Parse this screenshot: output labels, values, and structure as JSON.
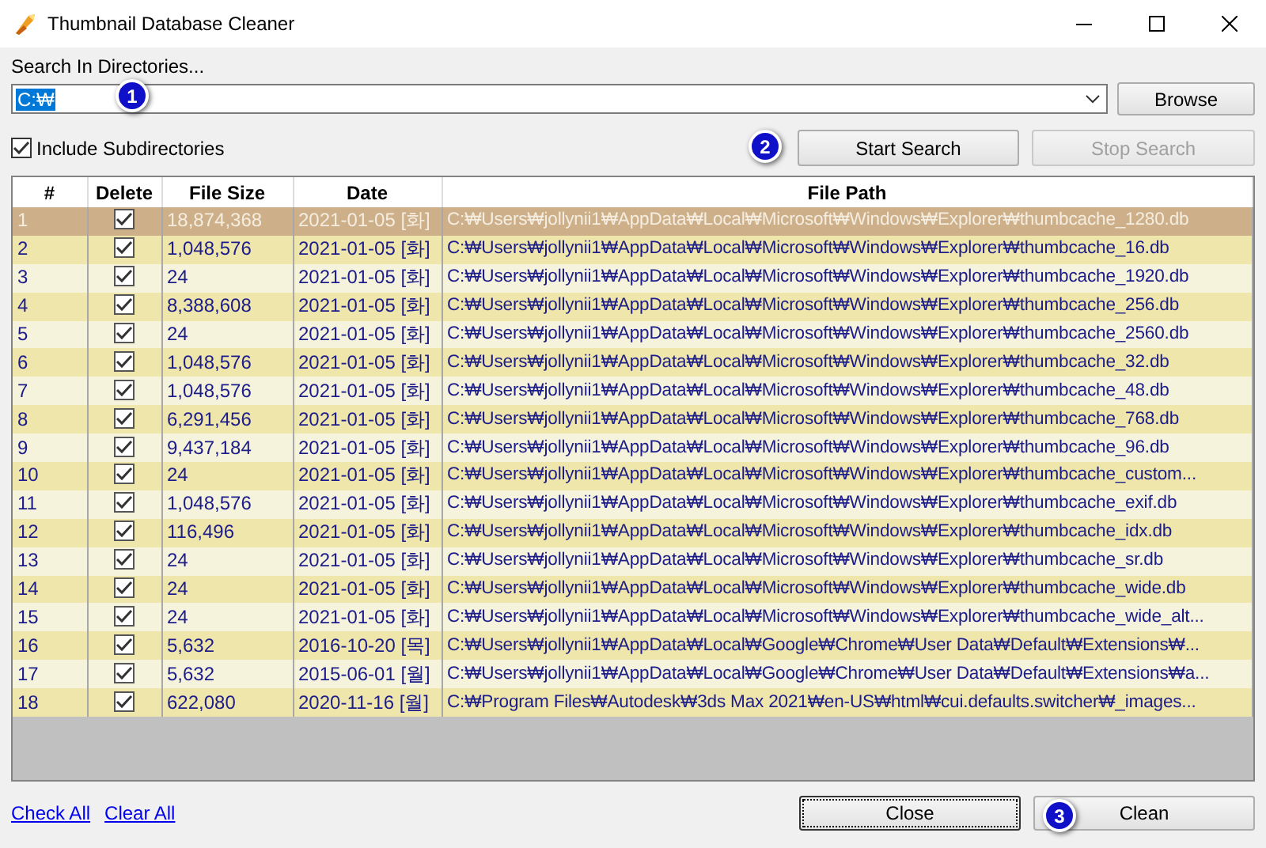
{
  "window": {
    "title": "Thumbnail Database Cleaner"
  },
  "search": {
    "label": "Search In Directories...",
    "value": "C:₩",
    "value_highlighted": true,
    "marker": "1",
    "browse": "Browse"
  },
  "options": {
    "include_subdirectories": {
      "label": "Include Subdirectories",
      "checked": true
    },
    "marker": "2",
    "start_search": {
      "label": "Start Search",
      "disabled": false
    },
    "stop_search": {
      "label": "Stop Search",
      "disabled": true
    }
  },
  "table": {
    "columns": [
      "#",
      "Delete",
      "File Size",
      "Date",
      "File Path"
    ],
    "rows": [
      {
        "number": "1",
        "delete": true,
        "file_size": "18,874,368",
        "date": "2021-01-05 [화]",
        "file_path": "C:₩Users₩jollynii1₩AppData₩Local₩Microsoft₩Windows₩Explorer₩thumbcache_1280.db",
        "selected": true
      },
      {
        "number": "2",
        "delete": true,
        "file_size": "1,048,576",
        "date": "2021-01-05 [화]",
        "file_path": "C:₩Users₩jollynii1₩AppData₩Local₩Microsoft₩Windows₩Explorer₩thumbcache_16.db",
        "selected": false
      },
      {
        "number": "3",
        "delete": true,
        "file_size": "24",
        "date": "2021-01-05 [화]",
        "file_path": "C:₩Users₩jollynii1₩AppData₩Local₩Microsoft₩Windows₩Explorer₩thumbcache_1920.db",
        "selected": false
      },
      {
        "number": "4",
        "delete": true,
        "file_size": "8,388,608",
        "date": "2021-01-05 [화]",
        "file_path": "C:₩Users₩jollynii1₩AppData₩Local₩Microsoft₩Windows₩Explorer₩thumbcache_256.db",
        "selected": false
      },
      {
        "number": "5",
        "delete": true,
        "file_size": "24",
        "date": "2021-01-05 [화]",
        "file_path": "C:₩Users₩jollynii1₩AppData₩Local₩Microsoft₩Windows₩Explorer₩thumbcache_2560.db",
        "selected": false
      },
      {
        "number": "6",
        "delete": true,
        "file_size": "1,048,576",
        "date": "2021-01-05 [화]",
        "file_path": "C:₩Users₩jollynii1₩AppData₩Local₩Microsoft₩Windows₩Explorer₩thumbcache_32.db",
        "selected": false
      },
      {
        "number": "7",
        "delete": true,
        "file_size": "1,048,576",
        "date": "2021-01-05 [화]",
        "file_path": "C:₩Users₩jollynii1₩AppData₩Local₩Microsoft₩Windows₩Explorer₩thumbcache_48.db",
        "selected": false
      },
      {
        "number": "8",
        "delete": true,
        "file_size": "6,291,456",
        "date": "2021-01-05 [화]",
        "file_path": "C:₩Users₩jollynii1₩AppData₩Local₩Microsoft₩Windows₩Explorer₩thumbcache_768.db",
        "selected": false
      },
      {
        "number": "9",
        "delete": true,
        "file_size": "9,437,184",
        "date": "2021-01-05 [화]",
        "file_path": "C:₩Users₩jollynii1₩AppData₩Local₩Microsoft₩Windows₩Explorer₩thumbcache_96.db",
        "selected": false
      },
      {
        "number": "10",
        "delete": true,
        "file_size": "24",
        "date": "2021-01-05 [화]",
        "file_path": "C:₩Users₩jollynii1₩AppData₩Local₩Microsoft₩Windows₩Explorer₩thumbcache_custom...",
        "selected": false
      },
      {
        "number": "11",
        "delete": true,
        "file_size": "1,048,576",
        "date": "2021-01-05 [화]",
        "file_path": "C:₩Users₩jollynii1₩AppData₩Local₩Microsoft₩Windows₩Explorer₩thumbcache_exif.db",
        "selected": false
      },
      {
        "number": "12",
        "delete": true,
        "file_size": "116,496",
        "date": "2021-01-05 [화]",
        "file_path": "C:₩Users₩jollynii1₩AppData₩Local₩Microsoft₩Windows₩Explorer₩thumbcache_idx.db",
        "selected": false
      },
      {
        "number": "13",
        "delete": true,
        "file_size": "24",
        "date": "2021-01-05 [화]",
        "file_path": "C:₩Users₩jollynii1₩AppData₩Local₩Microsoft₩Windows₩Explorer₩thumbcache_sr.db",
        "selected": false
      },
      {
        "number": "14",
        "delete": true,
        "file_size": "24",
        "date": "2021-01-05 [화]",
        "file_path": "C:₩Users₩jollynii1₩AppData₩Local₩Microsoft₩Windows₩Explorer₩thumbcache_wide.db",
        "selected": false
      },
      {
        "number": "15",
        "delete": true,
        "file_size": "24",
        "date": "2021-01-05 [화]",
        "file_path": "C:₩Users₩jollynii1₩AppData₩Local₩Microsoft₩Windows₩Explorer₩thumbcache_wide_alt...",
        "selected": false
      },
      {
        "number": "16",
        "delete": true,
        "file_size": "5,632",
        "date": "2016-10-20 [목]",
        "file_path": "C:₩Users₩jollynii1₩AppData₩Local₩Google₩Chrome₩User Data₩Default₩Extensions₩...",
        "selected": false
      },
      {
        "number": "17",
        "delete": true,
        "file_size": "5,632",
        "date": "2015-06-01 [월]",
        "file_path": "C:₩Users₩jollynii1₩AppData₩Local₩Google₩Chrome₩User Data₩Default₩Extensions₩a...",
        "selected": false
      },
      {
        "number": "18",
        "delete": true,
        "file_size": "622,080",
        "date": "2020-11-16 [월]",
        "file_path": "C:₩Program Files₩Autodesk₩3ds Max 2021₩en-US₩html₩cui.defaults.switcher₩_images...",
        "selected": false
      }
    ]
  },
  "footer": {
    "links": [
      "Check All",
      "Clear All"
    ],
    "close": {
      "label": "Close",
      "focused": true
    },
    "clean": {
      "label": "Clean",
      "focused": false
    },
    "marker": "3"
  }
}
